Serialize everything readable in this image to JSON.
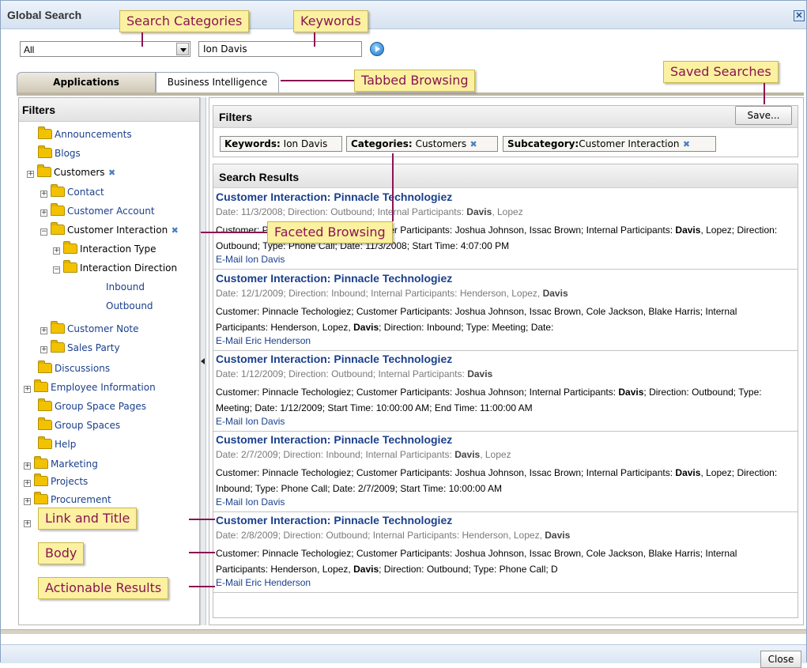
{
  "window": {
    "title": "Global Search",
    "close_glyph": "✕"
  },
  "search": {
    "category_value": "All",
    "keywords_value": "Ion Davis"
  },
  "tabs": [
    {
      "label": "Applications",
      "selected": true
    },
    {
      "label": "Business Intelligence",
      "selected": false
    }
  ],
  "left": {
    "header": "Filters",
    "tree": [
      {
        "label": "Announcements",
        "expander": ""
      },
      {
        "label": "Blogs",
        "expander": ""
      },
      {
        "label": "Customers",
        "expander": "+",
        "removable": true
      },
      {
        "label": "Contact",
        "expander": "+"
      },
      {
        "label": "Customer Account",
        "expander": "+"
      },
      {
        "label": "Customer Interaction",
        "expander": "−",
        "removable": true
      },
      {
        "label": "Interaction Type",
        "expander": "+"
      },
      {
        "label": "Interaction Direction",
        "expander": "−"
      },
      {
        "label": "Inbound"
      },
      {
        "label": "Outbound"
      },
      {
        "label": "Customer Note",
        "expander": "+"
      },
      {
        "label": "Sales Party",
        "expander": "+"
      },
      {
        "label": "Discussions",
        "expander": ""
      },
      {
        "label": "Employee Information",
        "expander": "+"
      },
      {
        "label": "Group Space Pages",
        "expander": ""
      },
      {
        "label": "Group Spaces",
        "expander": ""
      },
      {
        "label": "Help",
        "expander": ""
      },
      {
        "label": "Marketing",
        "expander": "+"
      },
      {
        "label": "Projects",
        "expander": "+"
      },
      {
        "label": "Procurement",
        "expander": "+"
      }
    ]
  },
  "filters": {
    "header": "Filters",
    "save_label": "Save...",
    "chips": [
      {
        "key": "Keywords:",
        "value": "Ion Davis",
        "removable": false
      },
      {
        "key": "Categories:",
        "value": "Customers",
        "removable": true
      },
      {
        "key": "Subcategory:",
        "value": "Customer Interaction",
        "removable": true
      }
    ]
  },
  "results": {
    "header": "Search Results",
    "items": [
      {
        "title": "Customer Interaction: Pinnacle Technologiez",
        "meta_pre": "Date: 11/3/2008; Direction: Outbound; Internal Participants: ",
        "meta_bold": "Davis",
        "meta_post": ", Lopez",
        "body_pre": "Customer: Pinnacle Techologiez; Customer Participants: Joshua Johnson, Issac Brown; Internal Participants: ",
        "body_bold": "Davis",
        "body_post": ", Lopez; Direction: Outbound; Type: Phone Call; Date: 11/3/2008; Start Time: 4:07:00 PM",
        "link": "E-Mail Ion Davis"
      },
      {
        "title": "Customer Interaction: Pinnacle Technologiez",
        "meta_pre": "Date: 12/1/2009; Direction: Inbound; Internal Participants: Henderson, Lopez, ",
        "meta_bold": "Davis",
        "meta_post": "",
        "body_pre": "Customer: Pinnacle Techologiez; Customer Participants: Joshua Johnson, Issac Brown, Cole Jackson, Blake Harris; Internal Participants: Henderson, Lopez, ",
        "body_bold": "Davis",
        "body_post": "; Direction: Inbound; Type: Meeting; Date:",
        "link": "E-Mail Eric Henderson"
      },
      {
        "title": "Customer Interaction: Pinnacle Technologiez",
        "meta_pre": "Date: 1/12/2009; Direction: Outbound; Internal Participants: ",
        "meta_bold": "Davis",
        "meta_post": "",
        "body_pre": "Customer: Pinnacle Techologiez; Customer Participants: Joshua Johnson; Internal Participants: ",
        "body_bold": "Davis",
        "body_post": "; Direction: Outbound; Type: Meeting; Date: 1/12/2009; Start Time: 10:00:00 AM; End Time: 11:00:00 AM",
        "link": "E-Mail Ion Davis"
      },
      {
        "title": "Customer Interaction: Pinnacle Technologiez",
        "meta_pre": "Date: 2/7/2009; Direction: Inbound; Internal Participants: ",
        "meta_bold": "Davis",
        "meta_post": ", Lopez",
        "body_pre": "Customer: Pinnacle Techologiez; Customer Participants: Joshua Johnson, Issac Brown; Internal Participants: ",
        "body_bold": "Davis",
        "body_post": ", Lopez; Direction: Inbound; Type: Phone Call; Date: 2/7/2009; Start Time: 10:00:00 AM",
        "link": "E-Mail Ion Davis"
      },
      {
        "title": "Customer Interaction: Pinnacle Technologiez",
        "meta_pre": "Date: 2/8/2009; Direction: Outbound; Internal Participants: Henderson, Lopez, ",
        "meta_bold": "Davis",
        "meta_post": "",
        "body_pre": "Customer: Pinnacle Techologiez; Customer Participants: Joshua Johnson, Issac Brown, Cole Jackson, Blake Harris; Internal Participants: Henderson, Lopez, ",
        "body_bold": "Davis",
        "body_post": "; Direction: Outbound; Type: Phone Call; D",
        "link": "E-Mail Eric Henderson"
      }
    ]
  },
  "footer": {
    "close_label": "Close"
  },
  "callouts": {
    "search_categories": "Search Categories",
    "keywords": "Keywords",
    "tabbed_browsing": "Tabbed Browsing",
    "saved_searches": "Saved Searches",
    "faceted_browsing": "Faceted Browsing",
    "link_and_title": "Link and Title",
    "body": "Body",
    "actionable_results": "Actionable Results"
  },
  "colors": {
    "callout_bg": "#fbf1a0",
    "callout_text": "#8a1552",
    "link": "#1a3f8c"
  }
}
